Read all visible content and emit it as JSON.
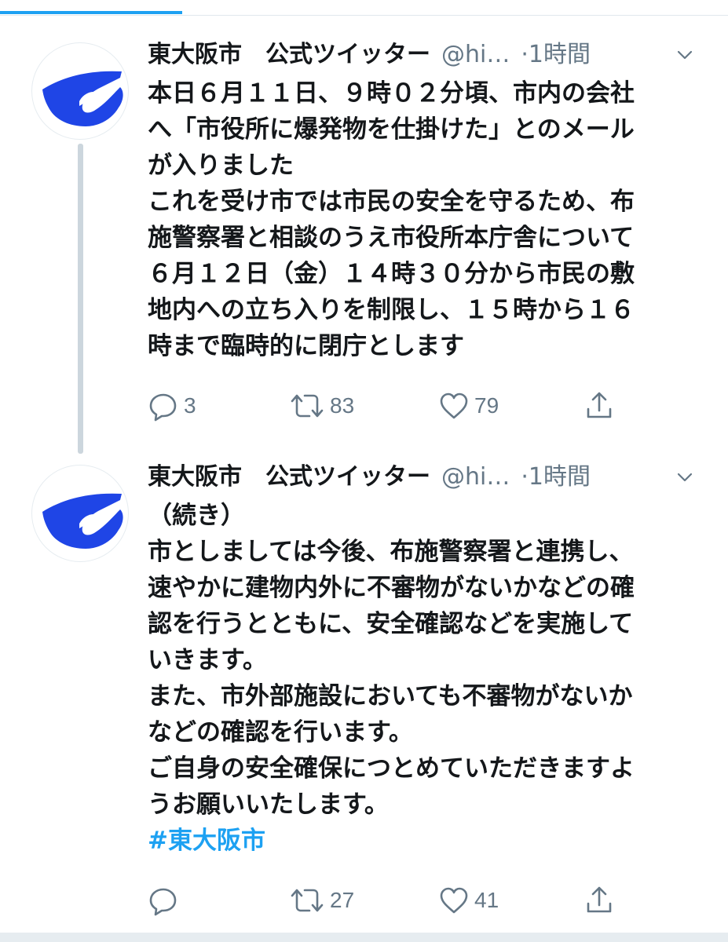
{
  "colors": {
    "accent": "#1da1f2",
    "text": "#14171a",
    "muted": "#657786",
    "logo_blue": "#1f45e6"
  },
  "tweets": [
    {
      "name": "東大阪市　公式ツイッター",
      "handle": "@hi…",
      "dot": "·",
      "time": "1時間",
      "lines": [
        "本日６月１１日、９時０２分頃、市内の会社",
        "へ「市役所に爆発物を仕掛けた」とのメール",
        "が入りました",
        "これを受け市では市民の安全を守るため、布",
        "施警察署と相談のうえ市役所本庁舎について",
        "６月１２日（金）１４時３０分から市民の敷",
        "地内への立ち入りを制限し、１５時から１６",
        "時まで臨時的に閉庁とします"
      ],
      "replies": "3",
      "retweets": "83",
      "likes": "79"
    },
    {
      "name": "東大阪市　公式ツイッター",
      "handle": "@hi…",
      "dot": "·",
      "time": "1時間",
      "lines": [
        "（続き）",
        "市としましては今後、布施警察署と連携し、",
        "速やかに建物内外に不審物がないかなどの確",
        "認を行うとともに、安全確認などを実施して",
        "いきます。",
        "また、市外部施設においても不審物がないか",
        "などの確認を行います。",
        "ご自身の安全確保につとめていただきますよ",
        "うお願いいたします。"
      ],
      "hashtag": "#東大阪市",
      "replies": "",
      "retweets": "27",
      "likes": "41"
    }
  ],
  "icons": {
    "avatar": "higashiosaka-logo-icon",
    "reply": "reply-icon",
    "retweet": "retweet-icon",
    "like": "heart-icon",
    "share": "share-icon",
    "menu": "chevron-down-icon"
  }
}
